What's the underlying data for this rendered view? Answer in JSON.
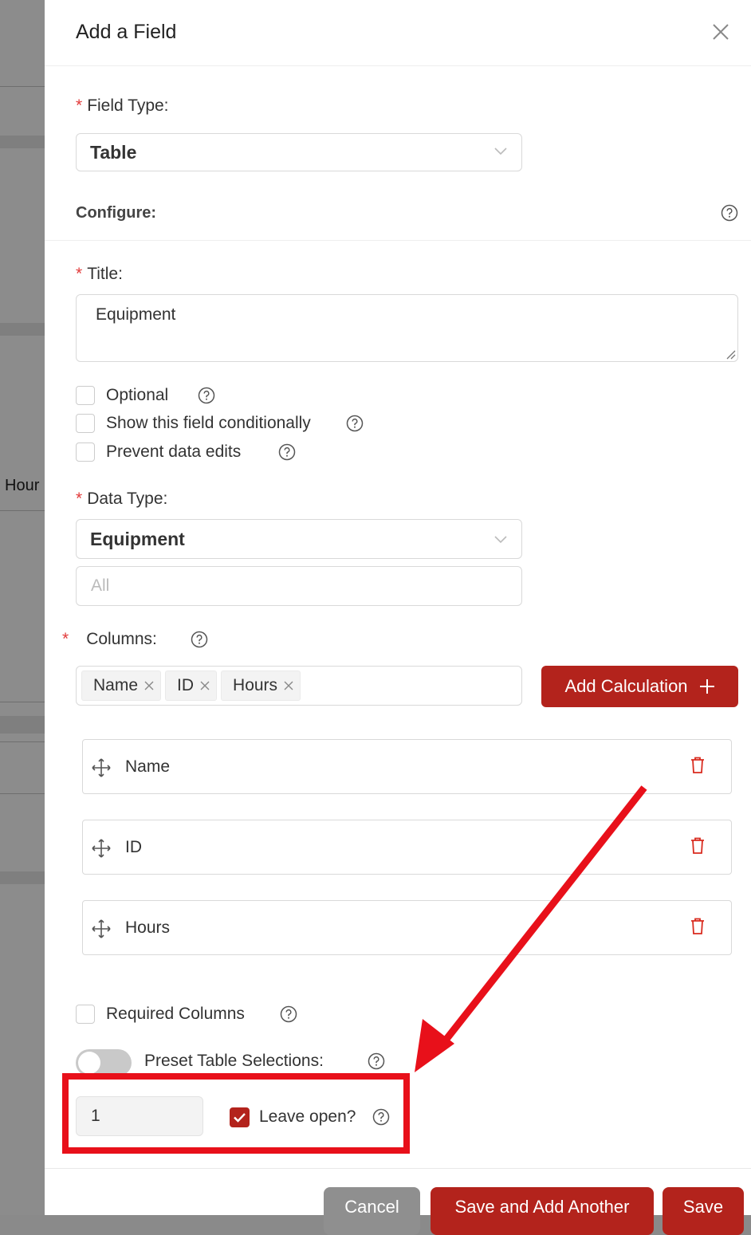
{
  "background": {
    "partial_text": "Hour"
  },
  "drawer": {
    "title": "Add a Field",
    "field_type": {
      "label": "Field Type:",
      "value": "Table"
    },
    "configure": {
      "label": "Configure:"
    },
    "title_field": {
      "label": "Title:",
      "value": "Equipment"
    },
    "checkboxes": [
      {
        "label": "Optional",
        "checked": false
      },
      {
        "label": "Show this field conditionally",
        "checked": false
      },
      {
        "label": "Prevent data edits",
        "checked": false
      }
    ],
    "data_type": {
      "label": "Data Type:",
      "value": "Equipment",
      "filter_placeholder": "All"
    },
    "columns": {
      "label": "Columns:",
      "tags": [
        "Name",
        "ID",
        "Hours"
      ],
      "add_calculation_label": "Add Calculation",
      "items": [
        "Name",
        "ID",
        "Hours"
      ]
    },
    "required_columns": {
      "label": "Required Columns",
      "checked": false
    },
    "preset_table_selections": {
      "label": "Preset Table Selections:",
      "enabled": false
    },
    "preset_count": "1",
    "leave_open": {
      "label": "Leave open?",
      "checked": true
    },
    "footer": {
      "cancel_label": "Cancel",
      "save_and_add_another_label": "Save and Add Another",
      "save_label": "Save"
    }
  },
  "colors": {
    "primary": "#b3231c",
    "required": "#e23b3b",
    "annotation": "#e8101a"
  }
}
